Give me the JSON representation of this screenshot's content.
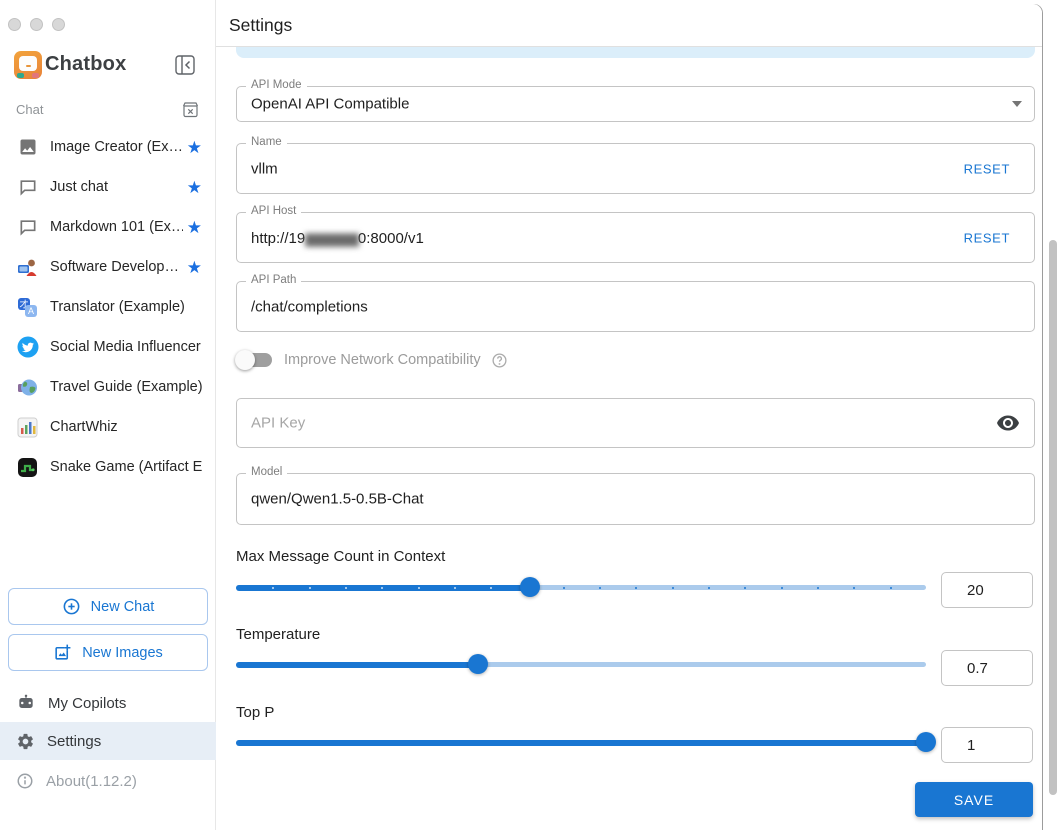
{
  "sidebar": {
    "app_title": "Chatbox",
    "section_label": "Chat",
    "items": [
      {
        "label": "Image Creator (Ex…",
        "icon": "image-icon",
        "starred": true
      },
      {
        "label": "Just chat",
        "icon": "chat-bubble-icon",
        "starred": true
      },
      {
        "label": "Markdown 101 (Ex…",
        "icon": "chat-bubble-icon",
        "starred": true
      },
      {
        "label": "Software Develop…",
        "icon": "developer-emoji-icon",
        "starred": true
      },
      {
        "label": "Translator (Example)",
        "icon": "translator-icon",
        "starred": false
      },
      {
        "label": "Social Media Influencer …",
        "icon": "twitter-bird-icon",
        "starred": false
      },
      {
        "label": "Travel Guide (Example)",
        "icon": "globe-icon",
        "starred": false
      },
      {
        "label": "ChartWhiz",
        "icon": "bar-chart-icon",
        "starred": false
      },
      {
        "label": "Snake Game (Artifact E…",
        "icon": "snake-game-icon",
        "starred": false
      }
    ],
    "new_chat_label": "New Chat",
    "new_images_label": "New Images",
    "my_copilots_label": "My Copilots",
    "settings_label": "Settings",
    "about_label": "About(1.12.2)"
  },
  "main": {
    "title": "Settings",
    "api_mode": {
      "label": "API Mode",
      "value": "OpenAI API Compatible"
    },
    "name_field": {
      "label": "Name",
      "value": "vllm",
      "reset_label": "RESET"
    },
    "api_host": {
      "label": "API Host",
      "value_prefix": "http://19",
      "value_redacted": "▆▆▆▆▆",
      "value_suffix": "0:8000/v1",
      "reset_label": "RESET"
    },
    "api_path": {
      "label": "API Path",
      "value": "/chat/completions"
    },
    "network_toggle": {
      "label": "Improve Network Compatibility",
      "state": "off"
    },
    "api_key": {
      "placeholder": "API Key"
    },
    "model": {
      "label": "Model",
      "value": "qwen/Qwen1.5-0.5B-Chat"
    },
    "sliders": [
      {
        "label": "Max Message Count in Context",
        "value": "20",
        "percent": 42.6,
        "ticks": 18
      },
      {
        "label": "Temperature",
        "value": "0.7",
        "percent": 35,
        "ticks": 0
      },
      {
        "label": "Top P",
        "value": "1",
        "percent": 100,
        "ticks": 0
      }
    ],
    "save_label": "SAVE"
  },
  "colors": {
    "accent": "#1976d2",
    "star": "#1a6fe0",
    "slider_rail": "#abcbec",
    "selected_row_bg": "#e7eef6",
    "scroll_hint_bar": "#dbeefa",
    "scrollbar_thumb": "#c2c2c2"
  }
}
